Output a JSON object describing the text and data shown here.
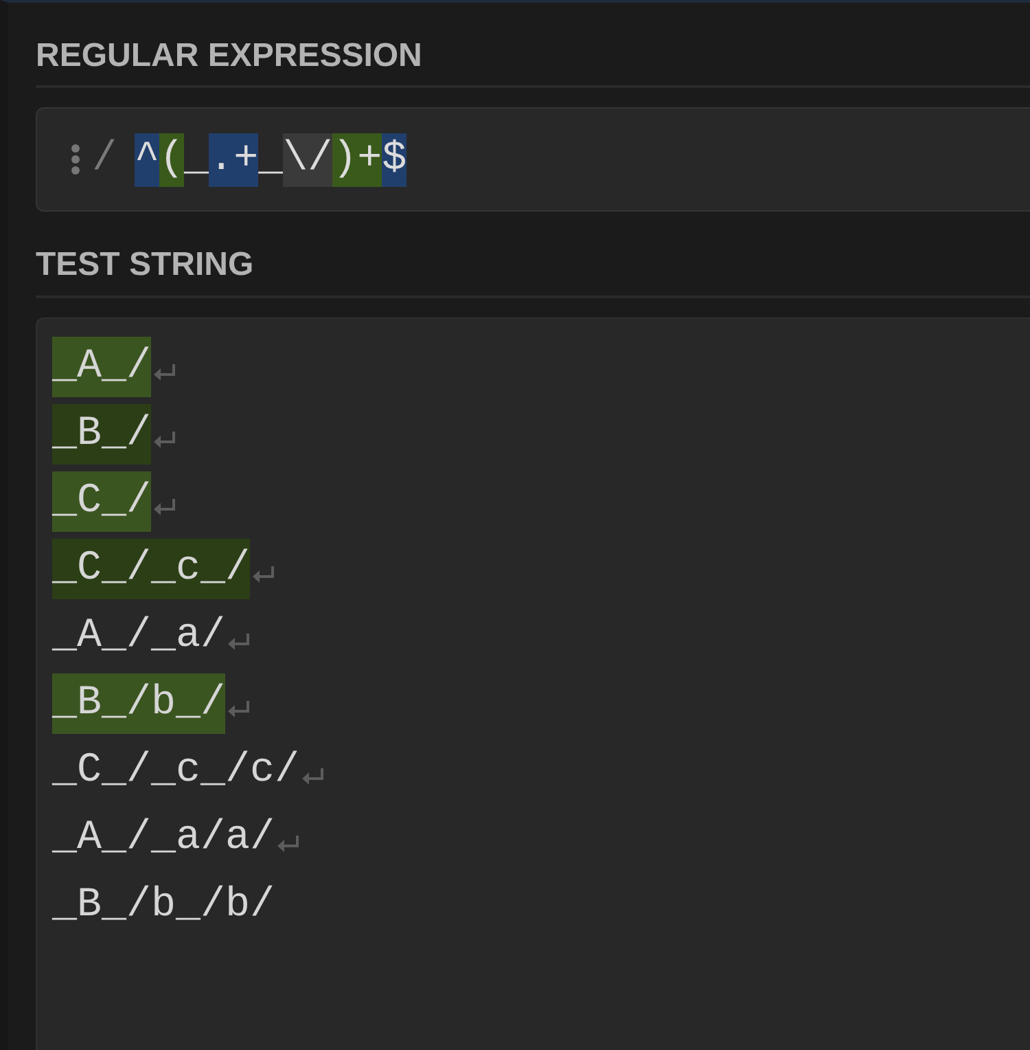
{
  "regular_expression": {
    "heading": "REGULAR EXPRESSION",
    "delimiter": "/",
    "tokens": [
      {
        "text": "^",
        "kind": "anchor"
      },
      {
        "text": "(",
        "kind": "group"
      },
      {
        "text": "_",
        "kind": "literal"
      },
      {
        "text": ".+",
        "kind": "meta"
      },
      {
        "text": "_",
        "kind": "literal"
      },
      {
        "text": "\\/",
        "kind": "escape"
      },
      {
        "text": ")+",
        "kind": "group"
      },
      {
        "text": "$",
        "kind": "anchor"
      }
    ]
  },
  "test_string": {
    "heading": "TEST STRING",
    "lines": [
      {
        "text": "_A_/",
        "matched": true,
        "color": "#3b5521",
        "line_break": true
      },
      {
        "text": "_B_/",
        "matched": true,
        "color": "#2b3e16",
        "line_break": true
      },
      {
        "text": "_C_/",
        "matched": true,
        "color": "#3b5521",
        "line_break": true
      },
      {
        "text": "_C_/_c_/",
        "matched": true,
        "color": "#2b3e16",
        "line_break": true
      },
      {
        "text": "_A_/_a/",
        "matched": false,
        "line_break": true
      },
      {
        "text": "_B_/b_/",
        "matched": true,
        "color": "#3b5521",
        "line_break": true
      },
      {
        "text": "_C_/_c_/c/",
        "matched": false,
        "line_break": true
      },
      {
        "text": "_A_/_a/a/",
        "matched": false,
        "line_break": true
      },
      {
        "text": "_B_/b_/b/",
        "matched": false,
        "line_break": false
      }
    ]
  }
}
